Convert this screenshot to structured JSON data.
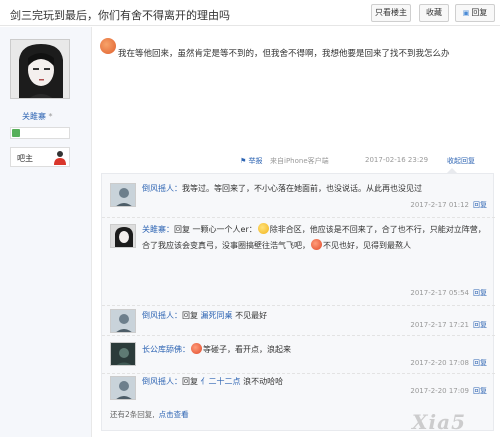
{
  "header": {
    "title": "剑三完玩到最后，你们有舍不得离开的理由吗",
    "only_owner_label": "只看楼主",
    "collect_label": "收藏",
    "reply_label": "回复"
  },
  "author": {
    "name": "关雎寨",
    "rank_label": "吧主"
  },
  "post": {
    "content": "我在等他回来，虽然肯定是等不到的，但我舍不得啊，我想他要是回来了找不到我怎么办",
    "report_label": "举报",
    "from_label": "来自iPhone客户端",
    "time": "2017-02-16 23:29",
    "collapse_label": "收起回复"
  },
  "replies": [
    {
      "name": "倒风摇人：",
      "text": "我等过。等回来了，不小心落在她面前，也没说话。从此再也没见过",
      "time": "2017-2-17 01:12",
      "reply_label": "回复"
    },
    {
      "name": "关雎寨：",
      "prefix": "回复 一颗心一个人er：",
      "text_a": "除非合区，他应该是不回来了，合了也不行，只能对立阵营，合了我应该会变真弓，没事圈搞壁往浩气飞吧，",
      "text_b": "不见也好，见得到最熬人",
      "time": "2017-2-17 05:54",
      "reply_label": "回复"
    },
    {
      "name": "倒风摇人：",
      "prefix": "回复",
      "target": "漏死同桌",
      "text": "不见最好",
      "time": "2017-2-17 17:21",
      "reply_label": "回复"
    },
    {
      "name": "长公库舔佛：",
      "text": "等碰子，看开点，浪起来",
      "time": "2017-2-20 17:08",
      "reply_label": "回复"
    },
    {
      "name": "倒风摇人：",
      "prefix": "回复",
      "target": "亻二十二点",
      "text": "浪不动哈哈",
      "time": "2017-2-20 17:09",
      "reply_label": "回复"
    }
  ],
  "footer": {
    "more_text": "还有2条回复,",
    "view_link": "点击查看"
  },
  "watermark": "Xia5"
}
